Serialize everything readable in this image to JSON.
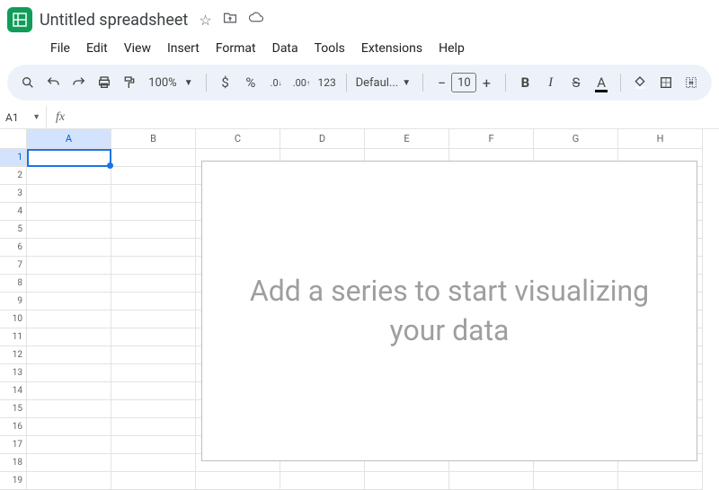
{
  "header": {
    "doc_title": "Untitled spreadsheet",
    "menus": [
      "File",
      "Edit",
      "View",
      "Insert",
      "Format",
      "Data",
      "Tools",
      "Extensions",
      "Help"
    ]
  },
  "toolbar": {
    "zoom": "100%",
    "currency": "$",
    "percent": "%",
    "dec_decrease": ".0",
    "dec_increase": ".00",
    "number_fmt": "123",
    "font": "Defaul...",
    "font_size": "10",
    "minus": "−",
    "plus": "+",
    "bold": "B",
    "italic": "I",
    "strike": "S",
    "textcolor": "A"
  },
  "namebox": "A1",
  "columns": [
    "A",
    "B",
    "C",
    "D",
    "E",
    "F",
    "G",
    "H"
  ],
  "rows": [
    "1",
    "2",
    "3",
    "4",
    "5",
    "6",
    "7",
    "8",
    "9",
    "10",
    "11",
    "12",
    "13",
    "14",
    "15",
    "16",
    "17",
    "18",
    "19"
  ],
  "selected_col": 0,
  "selected_row": 0,
  "chart_placeholder": "Add a series to start visualizing your data"
}
